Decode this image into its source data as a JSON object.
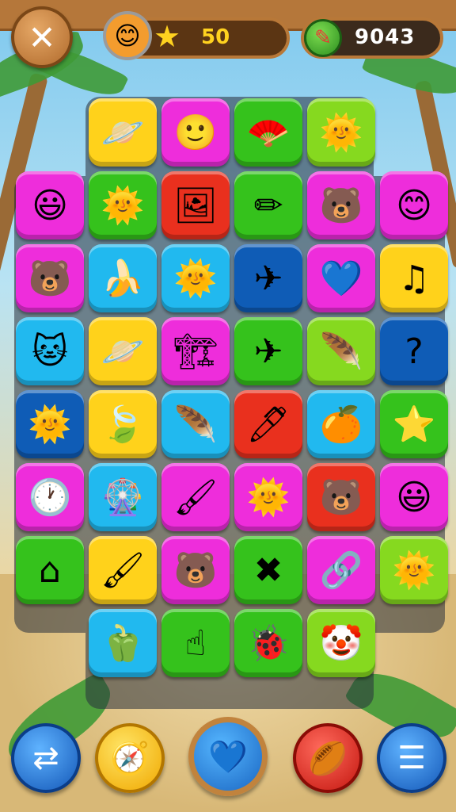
{
  "hud": {
    "close_glyph": "✕",
    "score_avatar_glyph": "😊",
    "score_star_glyph": "★",
    "score": "50",
    "coin_glyph": "✎",
    "coins": "9043"
  },
  "board": {
    "rows": [
      [
        {
          "color": "yellow",
          "icon": "planet-icon",
          "glyph": "🪐"
        },
        {
          "color": "magenta",
          "icon": "smiley-face-icon",
          "glyph": "🙂"
        },
        {
          "color": "green",
          "icon": "red-fan-icon",
          "glyph": "🪭"
        },
        {
          "color": "lime",
          "icon": "sun-face-icon",
          "glyph": "🌞"
        }
      ],
      [
        {
          "color": "magenta",
          "icon": "monster-face-icon",
          "glyph": "😃"
        },
        {
          "color": "green",
          "icon": "sun-face-icon",
          "glyph": "🌞"
        },
        {
          "color": "red",
          "icon": "framed-pencil-icon",
          "glyph": "🖼"
        },
        {
          "color": "green",
          "icon": "pencil-icon",
          "glyph": "✏"
        },
        {
          "color": "magenta",
          "icon": "bear-face-icon",
          "glyph": "🐻"
        },
        {
          "color": "magenta",
          "icon": "blue-face-icon",
          "glyph": "😊"
        }
      ],
      [
        {
          "color": "magenta",
          "icon": "bear-face-icon",
          "glyph": "🐻"
        },
        {
          "color": "cyan",
          "icon": "banana-icon",
          "glyph": "🍌"
        },
        {
          "color": "cyan",
          "icon": "sun-face-icon",
          "glyph": "🌞"
        },
        {
          "color": "navy",
          "icon": "paper-plane-icon",
          "glyph": "✈"
        },
        {
          "color": "magenta",
          "icon": "heart-icon",
          "glyph": "💙"
        },
        {
          "color": "yellow",
          "icon": "music-note-icon",
          "glyph": "♫"
        }
      ],
      [
        {
          "color": "cyan",
          "icon": "cat-face-icon",
          "glyph": "🐱"
        },
        {
          "color": "yellow",
          "icon": "planet-icon",
          "glyph": "🪐"
        },
        {
          "color": "magenta",
          "icon": "building-blocks-icon",
          "glyph": "🏗"
        },
        {
          "color": "green",
          "icon": "paper-plane-icon",
          "glyph": "✈"
        },
        {
          "color": "lime",
          "icon": "striped-feather-icon",
          "glyph": "🪶"
        },
        {
          "color": "navy",
          "icon": "question-hook-icon",
          "glyph": "?"
        }
      ],
      [
        {
          "color": "navy",
          "icon": "sun-face-icon",
          "glyph": "🌞"
        },
        {
          "color": "yellow",
          "icon": "leaf-icon",
          "glyph": "🍃"
        },
        {
          "color": "cyan",
          "icon": "striped-feather-icon",
          "glyph": "🪶"
        },
        {
          "color": "red",
          "icon": "pen-icon",
          "glyph": "🖊"
        },
        {
          "color": "cyan",
          "icon": "citrus-slice-icon",
          "glyph": "🍊"
        },
        {
          "color": "green",
          "icon": "star-icon",
          "glyph": "⭐"
        }
      ],
      [
        {
          "color": "magenta",
          "icon": "clock-icon",
          "glyph": "🕐"
        },
        {
          "color": "cyan",
          "icon": "fan-wheel-icon",
          "glyph": "🎡"
        },
        {
          "color": "magenta",
          "icon": "hook-brush-icon",
          "glyph": "🖌"
        },
        {
          "color": "magenta",
          "icon": "sun-face-icon",
          "glyph": "🌞"
        },
        {
          "color": "red",
          "icon": "bear-face-icon",
          "glyph": "🐻"
        },
        {
          "color": "magenta",
          "icon": "monster-face-icon",
          "glyph": "😃"
        }
      ],
      [
        {
          "color": "green",
          "icon": "house-icon",
          "glyph": "⌂"
        },
        {
          "color": "yellow",
          "icon": "paintbrush-icon",
          "glyph": "🖌"
        },
        {
          "color": "magenta",
          "icon": "bear-face-icon",
          "glyph": "🐻"
        },
        {
          "color": "green",
          "icon": "crossed-pencils-icon",
          "glyph": "✖"
        },
        {
          "color": "magenta",
          "icon": "link-icon",
          "glyph": "🔗"
        },
        {
          "color": "lime",
          "icon": "sun-face-icon",
          "glyph": "🌞"
        }
      ],
      [
        {
          "color": "cyan",
          "icon": "bell-pepper-icon",
          "glyph": "🫑"
        },
        {
          "color": "green",
          "icon": "finger-icon",
          "glyph": "☝"
        },
        {
          "color": "green",
          "icon": "ladybug-icon",
          "glyph": "🐞"
        },
        {
          "color": "lime",
          "icon": "clown-face-icon",
          "glyph": "🤡"
        }
      ]
    ]
  },
  "controls": {
    "shuffle_glyph": "⇄",
    "compass_glyph": "🧭",
    "heart_glyph": "💙",
    "ball_glyph": "🏉",
    "menu_glyph": "☰"
  },
  "colors": {
    "yellow": "#ffd21b",
    "magenta": "#ee2ddb",
    "green": "#35c21c",
    "lime": "#86d91f",
    "red": "#e9301e",
    "cyan": "#21b9ef",
    "navy": "#0f5cb6"
  }
}
